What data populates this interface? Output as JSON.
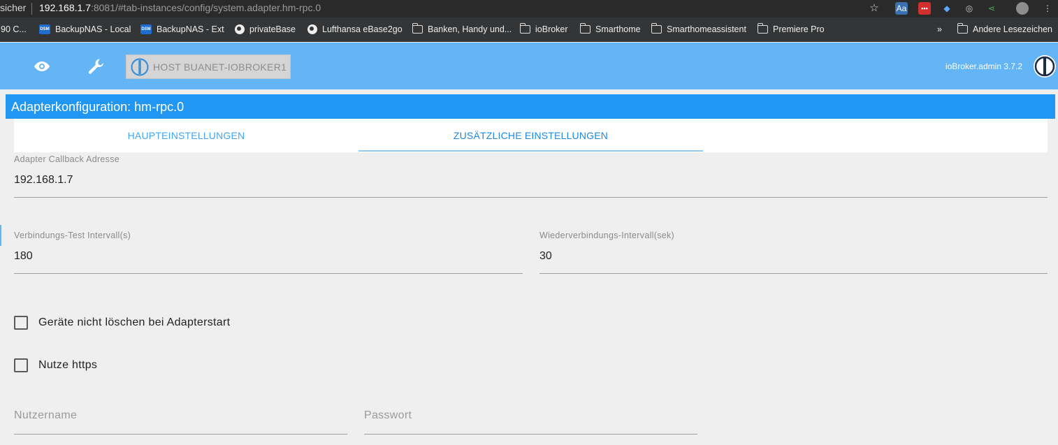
{
  "browser": {
    "security_label": "sicher",
    "url_host": "192.168.1.7",
    "url_rest": ":8081/#tab-instances/config/system.adapter.hm-rpc.0",
    "extension_label": "Aa"
  },
  "bookmarks": {
    "items": [
      {
        "label": "90 C...",
        "icon": "none"
      },
      {
        "label": "BackupNAS - Local",
        "icon": "dsm-icon"
      },
      {
        "label": "BackupNAS - Ext",
        "icon": "dsm-icon"
      },
      {
        "label": "privateBase",
        "icon": "globe-icon"
      },
      {
        "label": "Lufthansa eBase2go",
        "icon": "globe-icon"
      },
      {
        "label": "Banken, Handy und...",
        "icon": "folder-icon"
      },
      {
        "label": "ioBroker",
        "icon": "folder-icon"
      },
      {
        "label": "Smarthome",
        "icon": "folder-icon"
      },
      {
        "label": "Smarthomeassistent",
        "icon": "folder-icon"
      },
      {
        "label": "Premiere Pro",
        "icon": "folder-icon"
      }
    ],
    "overflow": "»",
    "other_bookmarks": "Andere Lesezeichen"
  },
  "header": {
    "host_label": "HOST BUANET-IOBROKER1",
    "version": "ioBroker.admin 3.7.2",
    "bar_color": "#64b5f6"
  },
  "config": {
    "title": "Adapterkonfiguration: hm-rpc.0",
    "title_color": "#2196f3",
    "tabs": [
      {
        "label": "HAUPTEINSTELLUNGEN",
        "active": false
      },
      {
        "label": "ZUSÄTZLICHE EINSTELLUNGEN",
        "active": true
      }
    ],
    "callback_address": {
      "label": "Adapter Callback Adresse",
      "value": "192.168.1.7"
    },
    "check_interval": {
      "label": "Verbindungs-Test Intervall(s)",
      "value": "180"
    },
    "reconnect_interval": {
      "label": "Wiederverbindungs-Intervall(sek)",
      "value": "30"
    },
    "checkbox_dont_delete": {
      "label": "Geräte nicht löschen bei Adapterstart",
      "checked": false
    },
    "checkbox_https": {
      "label": "Nutze https",
      "checked": false
    },
    "username": {
      "placeholder": "Nutzername",
      "value": ""
    },
    "password": {
      "placeholder": "Passwort",
      "value": ""
    }
  }
}
